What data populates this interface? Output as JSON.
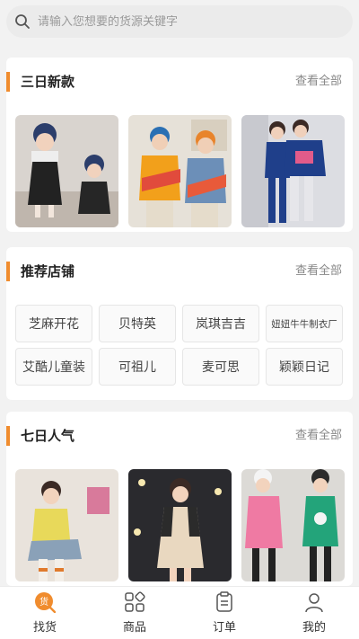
{
  "search": {
    "placeholder": "请输入您想要的货源关键字"
  },
  "sections": {
    "new3": {
      "title": "三日新款",
      "more": "查看全部"
    },
    "shops": {
      "title": "推荐店铺",
      "more": "查看全部",
      "items": [
        "芝麻开花",
        "贝特英",
        "岚琪吉吉",
        "妞妞牛牛制衣厂",
        "艾酷儿童装",
        "可祖儿",
        "麦可思",
        "颖颖日记"
      ]
    },
    "hot7": {
      "title": "七日人气",
      "more": "查看全部"
    }
  },
  "tabs": [
    {
      "label": "找货",
      "icon": "find-goods-icon"
    },
    {
      "label": "商品",
      "icon": "products-grid-icon"
    },
    {
      "label": "订单",
      "icon": "order-clipboard-icon"
    },
    {
      "label": "我的",
      "icon": "user-profile-icon"
    }
  ],
  "colors": {
    "accent": "#f08c2e",
    "background": "#f2f2f2"
  }
}
